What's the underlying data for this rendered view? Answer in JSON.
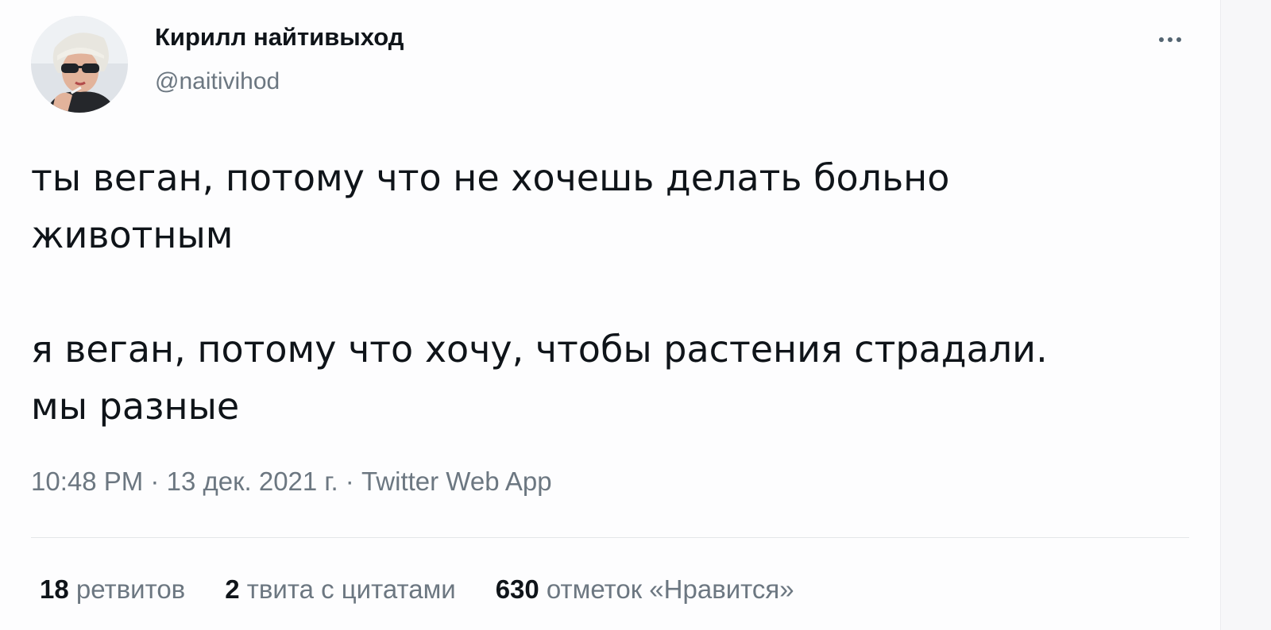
{
  "author": {
    "display_name": "Кирилл найтивыход",
    "handle": "@naitivihod",
    "avatar": "profile-photo"
  },
  "tweet": {
    "paragraphs": [
      "ты веган, потому что не хочешь делать больно\nживотным",
      "я веган, потому что хочу, чтобы растения страдали.\nмы разные"
    ],
    "time": "10:48 PM",
    "date": "13 дек. 2021 г.",
    "source": "Twitter Web App",
    "separator": "·"
  },
  "stats": {
    "retweets": {
      "count": "18",
      "label": "ретвитов"
    },
    "quotes": {
      "count": "2",
      "label": "твита с цитатами"
    },
    "likes": {
      "count": "630",
      "label": "отметок «Нравится»"
    }
  },
  "icons": {
    "more": "more-horizontal-icon"
  }
}
